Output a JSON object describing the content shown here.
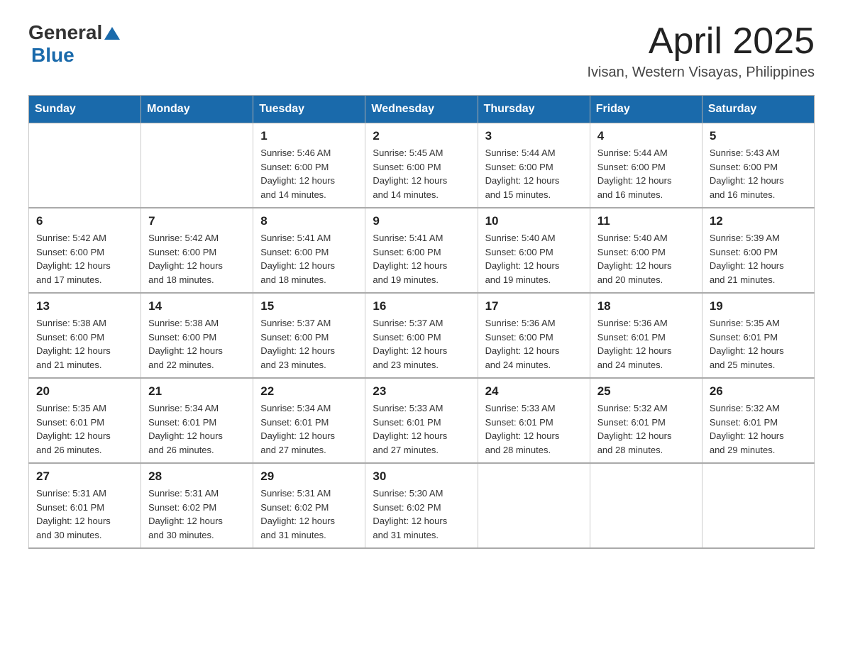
{
  "header": {
    "logo_general": "General",
    "logo_blue": "Blue",
    "month_title": "April 2025",
    "location": "Ivisan, Western Visayas, Philippines"
  },
  "calendar": {
    "days_of_week": [
      "Sunday",
      "Monday",
      "Tuesday",
      "Wednesday",
      "Thursday",
      "Friday",
      "Saturday"
    ],
    "weeks": [
      [
        {
          "day": "",
          "info": ""
        },
        {
          "day": "",
          "info": ""
        },
        {
          "day": "1",
          "info": "Sunrise: 5:46 AM\nSunset: 6:00 PM\nDaylight: 12 hours\nand 14 minutes."
        },
        {
          "day": "2",
          "info": "Sunrise: 5:45 AM\nSunset: 6:00 PM\nDaylight: 12 hours\nand 14 minutes."
        },
        {
          "day": "3",
          "info": "Sunrise: 5:44 AM\nSunset: 6:00 PM\nDaylight: 12 hours\nand 15 minutes."
        },
        {
          "day": "4",
          "info": "Sunrise: 5:44 AM\nSunset: 6:00 PM\nDaylight: 12 hours\nand 16 minutes."
        },
        {
          "day": "5",
          "info": "Sunrise: 5:43 AM\nSunset: 6:00 PM\nDaylight: 12 hours\nand 16 minutes."
        }
      ],
      [
        {
          "day": "6",
          "info": "Sunrise: 5:42 AM\nSunset: 6:00 PM\nDaylight: 12 hours\nand 17 minutes."
        },
        {
          "day": "7",
          "info": "Sunrise: 5:42 AM\nSunset: 6:00 PM\nDaylight: 12 hours\nand 18 minutes."
        },
        {
          "day": "8",
          "info": "Sunrise: 5:41 AM\nSunset: 6:00 PM\nDaylight: 12 hours\nand 18 minutes."
        },
        {
          "day": "9",
          "info": "Sunrise: 5:41 AM\nSunset: 6:00 PM\nDaylight: 12 hours\nand 19 minutes."
        },
        {
          "day": "10",
          "info": "Sunrise: 5:40 AM\nSunset: 6:00 PM\nDaylight: 12 hours\nand 19 minutes."
        },
        {
          "day": "11",
          "info": "Sunrise: 5:40 AM\nSunset: 6:00 PM\nDaylight: 12 hours\nand 20 minutes."
        },
        {
          "day": "12",
          "info": "Sunrise: 5:39 AM\nSunset: 6:00 PM\nDaylight: 12 hours\nand 21 minutes."
        }
      ],
      [
        {
          "day": "13",
          "info": "Sunrise: 5:38 AM\nSunset: 6:00 PM\nDaylight: 12 hours\nand 21 minutes."
        },
        {
          "day": "14",
          "info": "Sunrise: 5:38 AM\nSunset: 6:00 PM\nDaylight: 12 hours\nand 22 minutes."
        },
        {
          "day": "15",
          "info": "Sunrise: 5:37 AM\nSunset: 6:00 PM\nDaylight: 12 hours\nand 23 minutes."
        },
        {
          "day": "16",
          "info": "Sunrise: 5:37 AM\nSunset: 6:00 PM\nDaylight: 12 hours\nand 23 minutes."
        },
        {
          "day": "17",
          "info": "Sunrise: 5:36 AM\nSunset: 6:00 PM\nDaylight: 12 hours\nand 24 minutes."
        },
        {
          "day": "18",
          "info": "Sunrise: 5:36 AM\nSunset: 6:01 PM\nDaylight: 12 hours\nand 24 minutes."
        },
        {
          "day": "19",
          "info": "Sunrise: 5:35 AM\nSunset: 6:01 PM\nDaylight: 12 hours\nand 25 minutes."
        }
      ],
      [
        {
          "day": "20",
          "info": "Sunrise: 5:35 AM\nSunset: 6:01 PM\nDaylight: 12 hours\nand 26 minutes."
        },
        {
          "day": "21",
          "info": "Sunrise: 5:34 AM\nSunset: 6:01 PM\nDaylight: 12 hours\nand 26 minutes."
        },
        {
          "day": "22",
          "info": "Sunrise: 5:34 AM\nSunset: 6:01 PM\nDaylight: 12 hours\nand 27 minutes."
        },
        {
          "day": "23",
          "info": "Sunrise: 5:33 AM\nSunset: 6:01 PM\nDaylight: 12 hours\nand 27 minutes."
        },
        {
          "day": "24",
          "info": "Sunrise: 5:33 AM\nSunset: 6:01 PM\nDaylight: 12 hours\nand 28 minutes."
        },
        {
          "day": "25",
          "info": "Sunrise: 5:32 AM\nSunset: 6:01 PM\nDaylight: 12 hours\nand 28 minutes."
        },
        {
          "day": "26",
          "info": "Sunrise: 5:32 AM\nSunset: 6:01 PM\nDaylight: 12 hours\nand 29 minutes."
        }
      ],
      [
        {
          "day": "27",
          "info": "Sunrise: 5:31 AM\nSunset: 6:01 PM\nDaylight: 12 hours\nand 30 minutes."
        },
        {
          "day": "28",
          "info": "Sunrise: 5:31 AM\nSunset: 6:02 PM\nDaylight: 12 hours\nand 30 minutes."
        },
        {
          "day": "29",
          "info": "Sunrise: 5:31 AM\nSunset: 6:02 PM\nDaylight: 12 hours\nand 31 minutes."
        },
        {
          "day": "30",
          "info": "Sunrise: 5:30 AM\nSunset: 6:02 PM\nDaylight: 12 hours\nand 31 minutes."
        },
        {
          "day": "",
          "info": ""
        },
        {
          "day": "",
          "info": ""
        },
        {
          "day": "",
          "info": ""
        }
      ]
    ]
  }
}
